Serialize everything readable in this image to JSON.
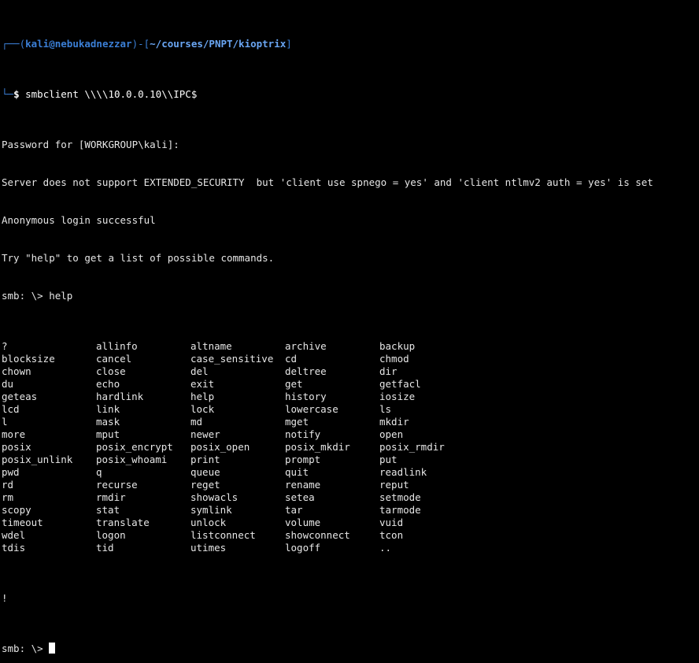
{
  "prompt": {
    "frame_top": "┌──(",
    "user_host": "kali@nebukadnezzar",
    "path_sep": ")-[",
    "path": "~/courses/PNPT/kioptrix",
    "path_end": "]",
    "frame_bottom": "└─",
    "dollar": "$",
    "command": " smbclient \\\\\\\\10.0.0.10\\\\IPC$"
  },
  "output": {
    "password": "Password for [WORKGROUP\\kali]:",
    "warning": "Server does not support EXTENDED_SECURITY  but 'client use spnego = yes' and 'client ntlmv2 auth = yes' is set",
    "anon": "Anonymous login successful",
    "hint": "Try \"help\" to get a list of possible commands.",
    "help_cmd": "smb: \\> help"
  },
  "commands": [
    [
      "?",
      "allinfo",
      "altname",
      "archive",
      "backup"
    ],
    [
      "blocksize",
      "cancel",
      "case_sensitive",
      "cd",
      "chmod"
    ],
    [
      "chown",
      "close",
      "del",
      "deltree",
      "dir"
    ],
    [
      "du",
      "echo",
      "exit",
      "get",
      "getfacl"
    ],
    [
      "geteas",
      "hardlink",
      "help",
      "history",
      "iosize"
    ],
    [
      "lcd",
      "link",
      "lock",
      "lowercase",
      "ls"
    ],
    [
      "l",
      "mask",
      "md",
      "mget",
      "mkdir"
    ],
    [
      "more",
      "mput",
      "newer",
      "notify",
      "open"
    ],
    [
      "posix",
      "posix_encrypt",
      "posix_open",
      "posix_mkdir",
      "posix_rmdir"
    ],
    [
      "posix_unlink",
      "posix_whoami",
      "print",
      "prompt",
      "put"
    ],
    [
      "pwd",
      "q",
      "queue",
      "quit",
      "readlink"
    ],
    [
      "rd",
      "recurse",
      "reget",
      "rename",
      "reput"
    ],
    [
      "rm",
      "rmdir",
      "showacls",
      "setea",
      "setmode"
    ],
    [
      "scopy",
      "stat",
      "symlink",
      "tar",
      "tarmode"
    ],
    [
      "timeout",
      "translate",
      "unlock",
      "volume",
      "vuid"
    ],
    [
      "wdel",
      "logon",
      "listconnect",
      "showconnect",
      "tcon"
    ],
    [
      "tdis",
      "tid",
      "utimes",
      "logoff",
      ".."
    ]
  ],
  "bang": "!",
  "final_prompt": "smb: \\> ",
  "colors": {
    "background": "#000000",
    "prompt_blue": "#3b7fd6",
    "path_blue": "#6aa6f3",
    "text": "#e6e6e6"
  }
}
